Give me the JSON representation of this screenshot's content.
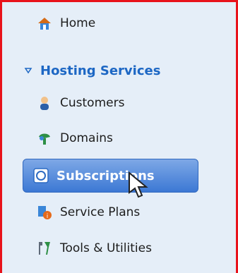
{
  "sidebar": {
    "items": [
      {
        "label": "Home",
        "icon": "home-icon"
      },
      {
        "label": "Customers",
        "icon": "customer-icon"
      },
      {
        "label": "Domains",
        "icon": "domains-icon"
      },
      {
        "label": "Subscriptions",
        "icon": "subscriptions-icon",
        "selected": true
      },
      {
        "label": "Service Plans",
        "icon": "service-plans-icon"
      },
      {
        "label": "Tools & Utilities",
        "icon": "tools-icon"
      }
    ],
    "section": {
      "label": "Hosting Services",
      "icon": "collapse-triangle-icon"
    }
  },
  "colors": {
    "panel_bg": "#e5eef8",
    "accent": "#1d67c4",
    "selected_bg": "#3c78d4",
    "frame_border": "#e8121b"
  }
}
